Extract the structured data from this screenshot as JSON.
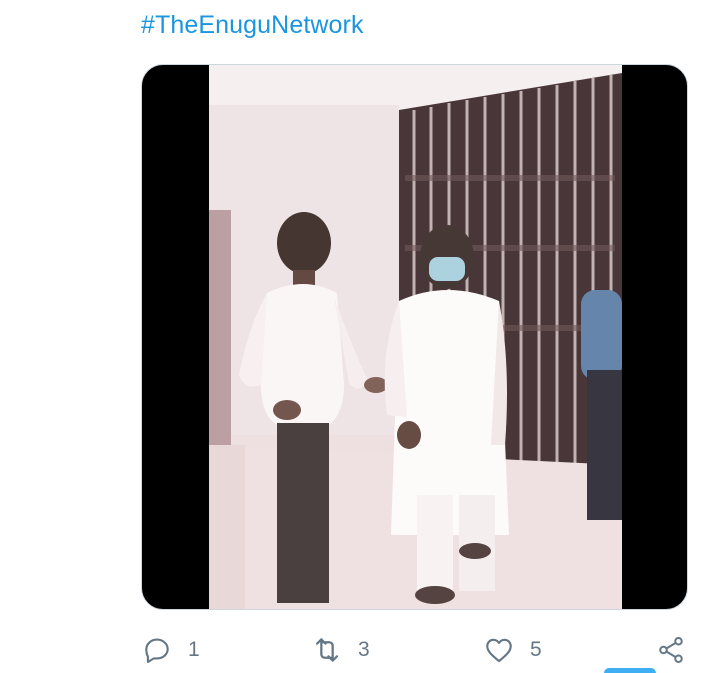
{
  "tweet": {
    "hashtag": "#TheEnuguNetwork",
    "media": {
      "type": "video",
      "description_icon": "video-thumbnail"
    }
  },
  "actions": {
    "reply": {
      "icon": "reply-icon",
      "count": "1"
    },
    "retweet": {
      "icon": "retweet-icon",
      "count": "3"
    },
    "like": {
      "icon": "heart-icon",
      "count": "5"
    },
    "share": {
      "icon": "share-icon"
    }
  },
  "colors": {
    "link": "#1b95e0",
    "icon_gray": "#657786",
    "card_border": "#ccd6dd",
    "letterbox": "#000000"
  }
}
